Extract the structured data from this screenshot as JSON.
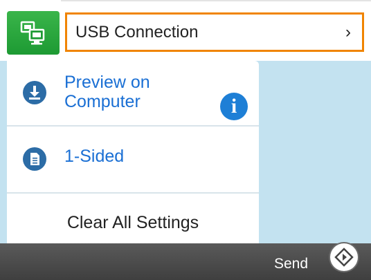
{
  "header": {
    "destination_icon": "computer-scan-icon",
    "connection_label": "USB Connection",
    "chevron": "›"
  },
  "settings": {
    "preview": {
      "label": "Preview on Computer",
      "icon": "download-icon",
      "info_icon": "info-icon",
      "info_glyph": "i"
    },
    "sided": {
      "label": "1-Sided",
      "icon": "document-icon"
    },
    "clear_all": {
      "label": "Clear All Settings"
    }
  },
  "footer": {
    "send_label": "Send",
    "send_icon": "start-diamond-icon"
  },
  "colors": {
    "accent_orange": "#f08400",
    "link_blue": "#1a6fd4",
    "green": "#1d9a33",
    "background_blue": "#c3e2f0"
  }
}
